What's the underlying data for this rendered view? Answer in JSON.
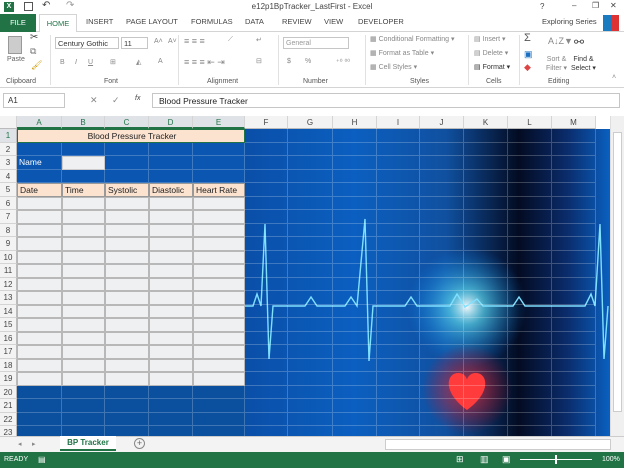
{
  "title": "e12p1BpTracker_LastFirst - Excel",
  "window_controls": {
    "help": "?",
    "minimize": "–",
    "restore": "❐",
    "close": "✕"
  },
  "tabs": [
    "FILE",
    "HOME",
    "INSERT",
    "PAGE LAYOUT",
    "FORMULAS",
    "DATA",
    "REVIEW",
    "VIEW",
    "DEVELOPER"
  ],
  "account": "Exploring Series",
  "ribbon": {
    "paste": "Paste",
    "clipboard": "Clipboard",
    "font_name": "Century Gothic",
    "font_size": "11",
    "font": "Font",
    "alignment": "Alignment",
    "number_format": "General",
    "number": "Number",
    "conditional_formatting": "Conditional Formatting",
    "format_as_table": "Format as Table",
    "cell_styles": "Cell Styles",
    "styles": "Styles",
    "insert": "Insert",
    "delete": "Delete",
    "format": "Format",
    "cells": "Cells",
    "sort_filter_1": "Sort &",
    "sort_filter_2": "Filter",
    "find_select_1": "Find &",
    "find_select_2": "Select",
    "editing": "Editing",
    "bold": "B",
    "italic": "I",
    "underline": "U",
    "sum": "Σ",
    "dollar": "$",
    "percent": "%"
  },
  "formula_bar": {
    "name_box": "A1",
    "fx": "fx",
    "content": "Blood Pressure Tracker"
  },
  "columns": [
    "A",
    "B",
    "C",
    "D",
    "E",
    "F",
    "G",
    "H",
    "I",
    "J",
    "K",
    "L",
    "M"
  ],
  "rows": [
    "1",
    "2",
    "3",
    "4",
    "5",
    "6",
    "7",
    "8",
    "9",
    "10",
    "11",
    "12",
    "13",
    "14",
    "15",
    "16",
    "17",
    "18",
    "19",
    "20",
    "21",
    "22",
    "23"
  ],
  "sheet": {
    "title": "Blood Pressure Tracker",
    "name_label": "Name",
    "headers": [
      "Date",
      "Time",
      "Systolic",
      "Diastolic",
      "Heart Rate"
    ]
  },
  "sheet_tab": "BP Tracker",
  "status": {
    "ready": "READY",
    "zoom": "100%"
  },
  "colors": {
    "excel_green": "#217346",
    "peach": "#fbe3d0"
  }
}
